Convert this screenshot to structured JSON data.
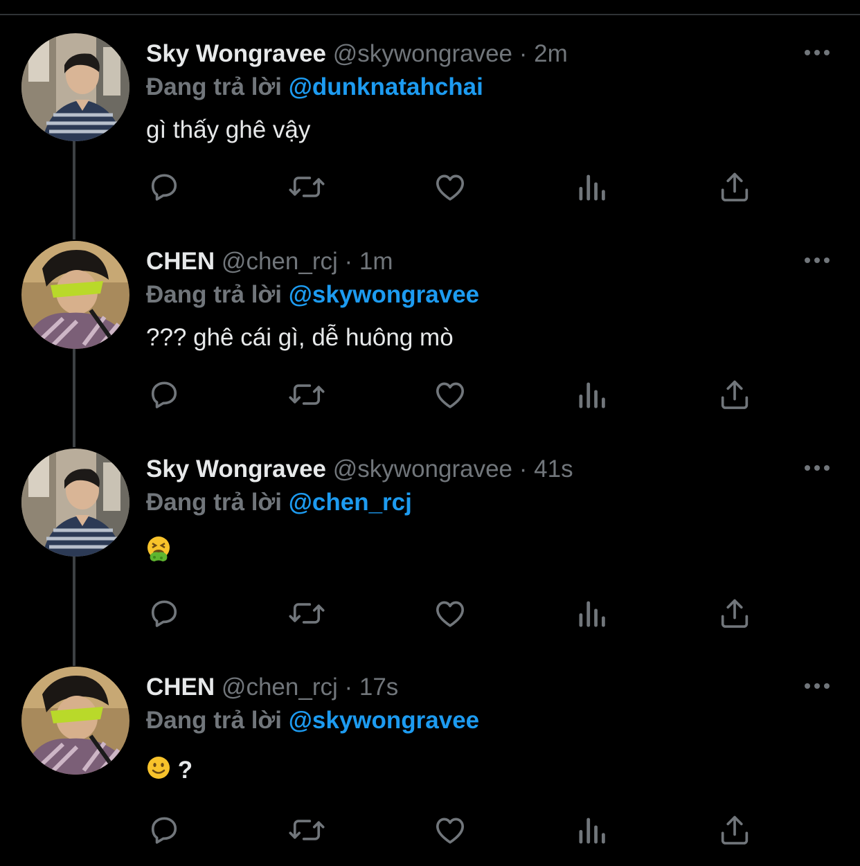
{
  "tweets": [
    {
      "name": "Sky Wongravee",
      "handle": "@skywongravee",
      "sep": "·",
      "time": "2m",
      "replying_label": "Đang trả lời",
      "replying_to": "@dunknatahchai",
      "text": "gì thấy ghê vậy",
      "avatar_icon": "avatar-sky"
    },
    {
      "name": "CHEN",
      "handle": "@chen_rcj",
      "sep": "·",
      "time": "1m",
      "replying_label": "Đang trả lời",
      "replying_to": "@skywongravee",
      "text": "??? ghê cái gì, dễ huông mò",
      "avatar_icon": "avatar-chen"
    },
    {
      "name": "Sky Wongravee",
      "handle": "@skywongravee",
      "sep": "·",
      "time": "41s",
      "replying_label": "Đang trả lời",
      "replying_to": "@chen_rcj",
      "text": "",
      "emoji": "vomiting-face-emoji",
      "avatar_icon": "avatar-sky"
    },
    {
      "name": "CHEN",
      "handle": "@chen_rcj",
      "sep": "·",
      "time": "17s",
      "replying_label": "Đang trả lời",
      "replying_to": "@skywongravee",
      "text": "?",
      "emoji": "slightly-smiling-face-emoji",
      "avatar_icon": "avatar-chen"
    }
  ],
  "actions": [
    "reply-icon",
    "retweet-icon",
    "like-icon",
    "analytics-icon",
    "share-icon"
  ],
  "colors": {
    "background": "#000000",
    "text_primary": "#e7e9ea",
    "text_secondary": "#71767b",
    "accent": "#1d9bf0",
    "thread_line": "#3d4144"
  }
}
